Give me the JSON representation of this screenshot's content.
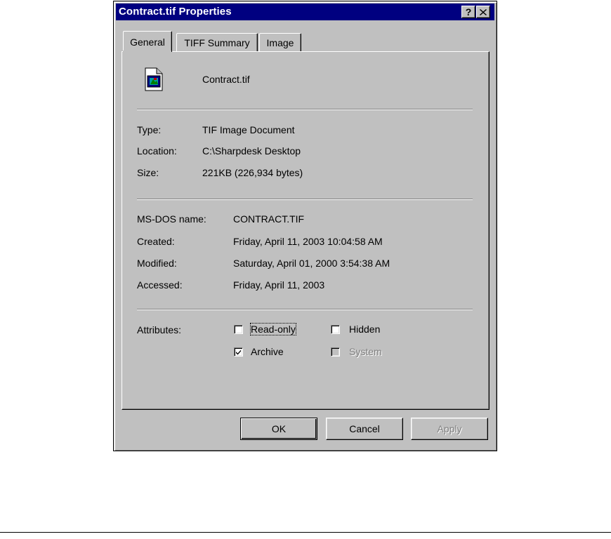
{
  "window": {
    "title": "Contract.tif Properties",
    "help_glyph": "?",
    "close_glyph": "✕"
  },
  "tabs": [
    {
      "label": "General",
      "active": true
    },
    {
      "label": "TIFF Summary",
      "active": false
    },
    {
      "label": "Image",
      "active": false
    }
  ],
  "file": {
    "name": "Contract.tif",
    "icon": "tif-image-file-icon"
  },
  "info": {
    "type_label": "Type:",
    "type_value": "TIF Image Document",
    "location_label": "Location:",
    "location_value": "C:\\Sharpdesk Desktop",
    "size_label": "Size:",
    "size_value": "221KB (226,934 bytes)"
  },
  "details": {
    "msdos_label": "MS-DOS name:",
    "msdos_value": "CONTRACT.TIF",
    "created_label": "Created:",
    "created_value": "Friday, April 11, 2003 10:04:58 AM",
    "modified_label": "Modified:",
    "modified_value": "Saturday, April 01, 2000 3:54:38 AM",
    "accessed_label": "Accessed:",
    "accessed_value": "Friday, April 11, 2003"
  },
  "attributes": {
    "label": "Attributes:",
    "read_only": {
      "label": "Read-only",
      "checked": false
    },
    "hidden": {
      "label": "Hidden",
      "checked": false
    },
    "archive": {
      "label": "Archive",
      "checked": true
    },
    "system": {
      "label": "System",
      "checked": false,
      "disabled": true
    }
  },
  "buttons": {
    "ok": "OK",
    "cancel": "Cancel",
    "apply": "Apply"
  },
  "colors": {
    "titlebar": "#000080",
    "face": "#c0c0c0"
  }
}
